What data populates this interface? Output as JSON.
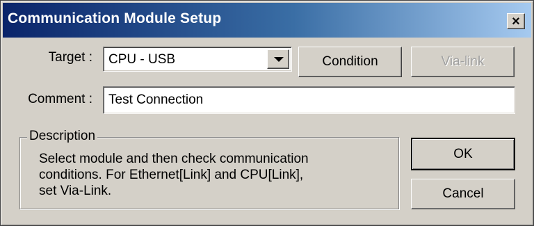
{
  "window": {
    "title": "Communication Module Setup",
    "close_label": "✕"
  },
  "target": {
    "label": "Target :",
    "value": "CPU - USB"
  },
  "comment": {
    "label": "Comment :",
    "value": "Test Connection"
  },
  "buttons": {
    "condition": "Condition",
    "via_link": "Via-link",
    "ok": "OK",
    "cancel": "Cancel"
  },
  "description": {
    "caption": "Description",
    "lines": [
      "Select module and then check communication",
      "conditions. For Ethernet[Link] and CPU[Link],",
      "set Via-Link."
    ]
  }
}
